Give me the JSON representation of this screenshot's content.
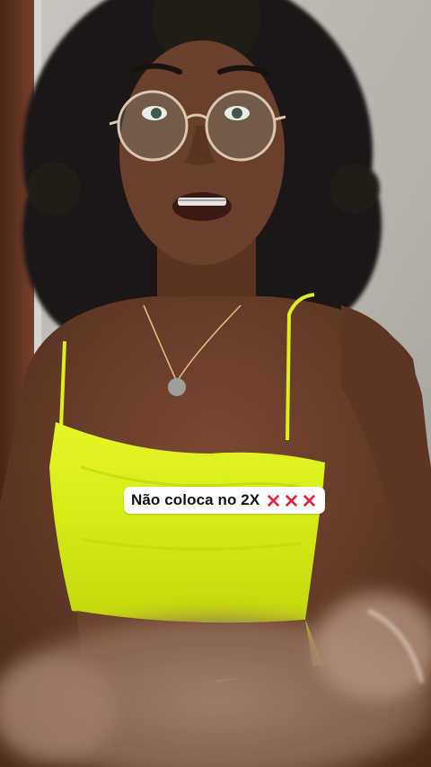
{
  "caption": {
    "text": "Não coloca no 2X",
    "icons": [
      "cross-mark-icon",
      "cross-mark-icon",
      "cross-mark-icon"
    ],
    "icon_color": "#e0213a"
  },
  "colors": {
    "top": "#dcf01e",
    "skin": "#6a3f2c",
    "hair": "#1c1512",
    "background_wall": "#b9b4ae",
    "door_frame": "#6b3b2a"
  }
}
